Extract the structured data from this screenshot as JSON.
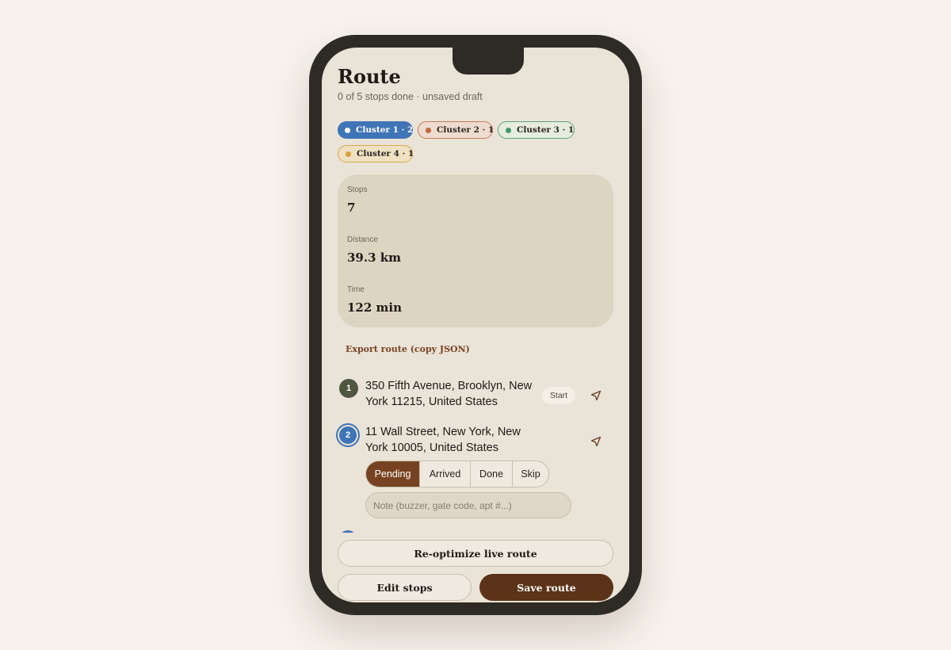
{
  "header": {
    "title": "Route",
    "subtitle": "0 of 5 stops done · unsaved draft"
  },
  "clusters": [
    {
      "label": "Cluster 1 · 2",
      "color": "#3f74b6",
      "selected": true
    },
    {
      "label": "Cluster 2 · 1",
      "color": "#c4673d",
      "selected": false
    },
    {
      "label": "Cluster 3 · 1",
      "color": "#3e9a6a",
      "selected": false
    },
    {
      "label": "Cluster 4 · 1",
      "color": "#d7a23c",
      "selected": false
    }
  ],
  "stats": {
    "stops": {
      "label": "Stops",
      "value": "7"
    },
    "distance": {
      "label": "Distance",
      "value": "39.3 km"
    },
    "time": {
      "label": "Time",
      "value": "122 min"
    }
  },
  "export_label": "Export route (copy JSON)",
  "stops": [
    {
      "number": "1",
      "address": "350 Fifth Avenue, Brooklyn, New York 11215, United States",
      "badge": "Start",
      "icon": "navigate-arrow-icon"
    },
    {
      "number": "2",
      "address": "11 Wall Street, New York, New York 10005, United States",
      "icon": "navigate-arrow-icon",
      "statuses": [
        "Pending",
        "Arrived",
        "Done",
        "Skip"
      ],
      "selected_status": "Pending",
      "note_placeholder": "Note (buzzer, gate code, apt #...)",
      "note_value": ""
    }
  ],
  "actions": {
    "reoptimize": "Re-optimize live route",
    "edit": "Edit stops",
    "save": "Save route"
  },
  "colors": {
    "accent": "#774221",
    "save": "#5b3318",
    "stop1": "#4f5740",
    "stop2": "#3f74b6"
  }
}
